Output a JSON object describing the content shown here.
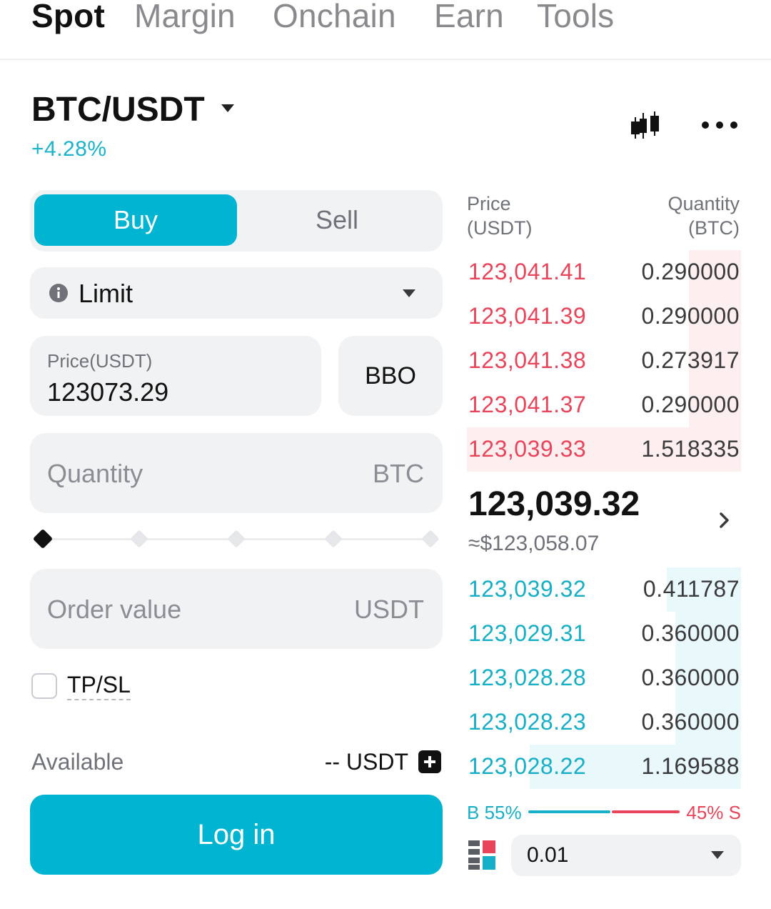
{
  "top_tabs": [
    {
      "label": "Spot",
      "active": true
    },
    {
      "label": "Margin",
      "active": false
    },
    {
      "label": "Onchain",
      "active": false
    },
    {
      "label": "Earn",
      "active": false
    },
    {
      "label": "Tools",
      "active": false
    }
  ],
  "header": {
    "pair": "BTC/USDT",
    "change": "+4.28%",
    "chart_icon": "candlestick-icon",
    "more_icon": "more-dots-icon"
  },
  "trade_form": {
    "buy_label": "Buy",
    "sell_label": "Sell",
    "selected_side": "Buy",
    "order_type": "Limit",
    "price_label": "Price(USDT)",
    "price_value": "123073.29",
    "bbo_label": "BBO",
    "quantity_placeholder": "Quantity",
    "quantity_unit": "BTC",
    "slider_level": 0,
    "order_value_placeholder": "Order value",
    "order_value_unit": "USDT",
    "tpsl_label": "TP/SL",
    "tpsl_checked": false,
    "available_label": "Available",
    "available_value": "-- USDT",
    "login_label": "Log in"
  },
  "order_book": {
    "price_header_line1": "Price",
    "price_header_line2": "(USDT)",
    "qty_header_line1": "Quantity",
    "qty_header_line2": "(BTC)",
    "asks": [
      {
        "price": "123,041.41",
        "qty": "0.290000",
        "depth": 0.19
      },
      {
        "price": "123,041.39",
        "qty": "0.290000",
        "depth": 0.19
      },
      {
        "price": "123,041.38",
        "qty": "0.273917",
        "depth": 0.19
      },
      {
        "price": "123,041.37",
        "qty": "0.290000",
        "depth": 0.19
      },
      {
        "price": "123,039.33",
        "qty": "1.518335",
        "depth": 1.0
      }
    ],
    "last_price": "123,039.32",
    "last_price_fiat": "≈$123,058.07",
    "bids": [
      {
        "price": "123,039.32",
        "qty": "0.411787",
        "depth": 0.27
      },
      {
        "price": "123,029.31",
        "qty": "0.360000",
        "depth": 0.24
      },
      {
        "price": "123,028.28",
        "qty": "0.360000",
        "depth": 0.24
      },
      {
        "price": "123,028.23",
        "qty": "0.360000",
        "depth": 0.24
      },
      {
        "price": "123,028.22",
        "qty": "1.169588",
        "depth": 0.77
      }
    ],
    "buy_ratio_label": "B 55%",
    "sell_ratio_label": "45% S",
    "buy_ratio": 0.55,
    "precision": "0.01"
  },
  "colors": {
    "accent": "#00b4d2",
    "ask": "#e8455b",
    "bid": "#17afc8"
  }
}
